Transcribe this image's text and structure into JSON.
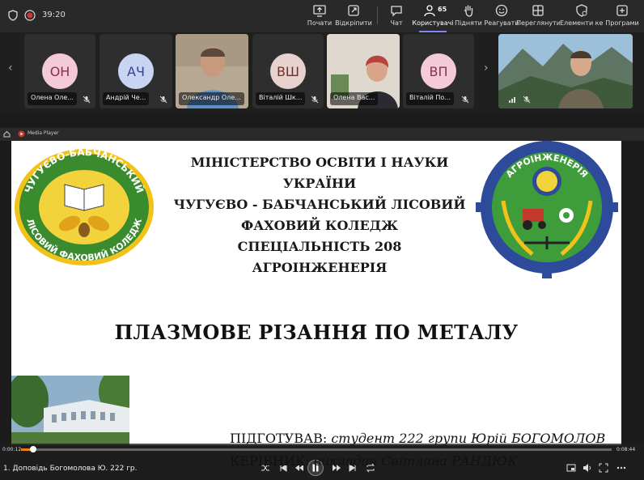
{
  "topbar": {
    "clock": "39:20",
    "buttons": [
      {
        "id": "share",
        "label": "Почати"
      },
      {
        "id": "popout",
        "label": "Відкріпити"
      },
      {
        "id": "chat",
        "label": "Чат"
      },
      {
        "id": "people",
        "label": "Користувачі",
        "count": "65"
      },
      {
        "id": "raise",
        "label": "Підняти"
      },
      {
        "id": "react",
        "label": "Реагувати"
      },
      {
        "id": "view",
        "label": "Переглянути"
      },
      {
        "id": "apps",
        "label": "Елементи ке..."
      },
      {
        "id": "more",
        "label": "Програми"
      }
    ]
  },
  "participants": [
    {
      "initials": "ОН",
      "name": "Олена Оле...",
      "color": "#f4c9d8",
      "text": "#8a2f54"
    },
    {
      "initials": "АЧ",
      "name": "Андрій Че...",
      "color": "#c8d4f2",
      "text": "#34448a"
    },
    {
      "initials": "",
      "name": "Олександр Оле...",
      "color": "",
      "text": ""
    },
    {
      "initials": "ВШ",
      "name": "Віталій Шк...",
      "color": "#e8d2cf",
      "text": "#6f2f2a"
    },
    {
      "initials": "",
      "name": "Олена Вас...",
      "color": "",
      "text": ""
    },
    {
      "initials": "ВП",
      "name": "Віталій По...",
      "color": "#f4c9d8",
      "text": "#8a2f54"
    }
  ],
  "stage": {
    "app_title": "Media Player",
    "slide": {
      "header_lines": [
        "МІНІСТЕРСТВО ОСВІТИ І НАУКИ УКРАЇНИ",
        "ЧУГУЄВО - БАБЧАНСЬКИЙ ЛІСОВИЙ",
        "ФАХОВИЙ КОЛЕДЖ",
        "СПЕЦІАЛЬНІСТЬ 208 АГРОІНЖЕНЕРІЯ"
      ],
      "left_logo_text_top": "ЧУГУЄВО-БАБЧАНСЬКИЙ",
      "left_logo_text_bottom": "ЛІСОВИЙ ФАХОВИЙ КОЛЕДЖ",
      "right_logo_text": "АГРОІНЖЕНЕРІЯ",
      "title": "ПЛАЗМОВЕ РІЗАННЯ ПО МЕТАЛУ",
      "prepared_label": "ПІДГОТУВАВ:",
      "prepared_value": "студент 222 групи Юрій БОГОМОЛОВ",
      "supervisor_label": "КЕРІВНИК:",
      "supervisor_value": "викладач Світлана РАНДЮК"
    }
  },
  "player": {
    "elapsed": "0:00:12",
    "total": "0:08:44",
    "progress": 0.02,
    "caption": "1. Доповідь Богомолова Ю. 222 гр."
  },
  "colors": {
    "accent": "#7f85f5",
    "progress": "#e67e22"
  }
}
